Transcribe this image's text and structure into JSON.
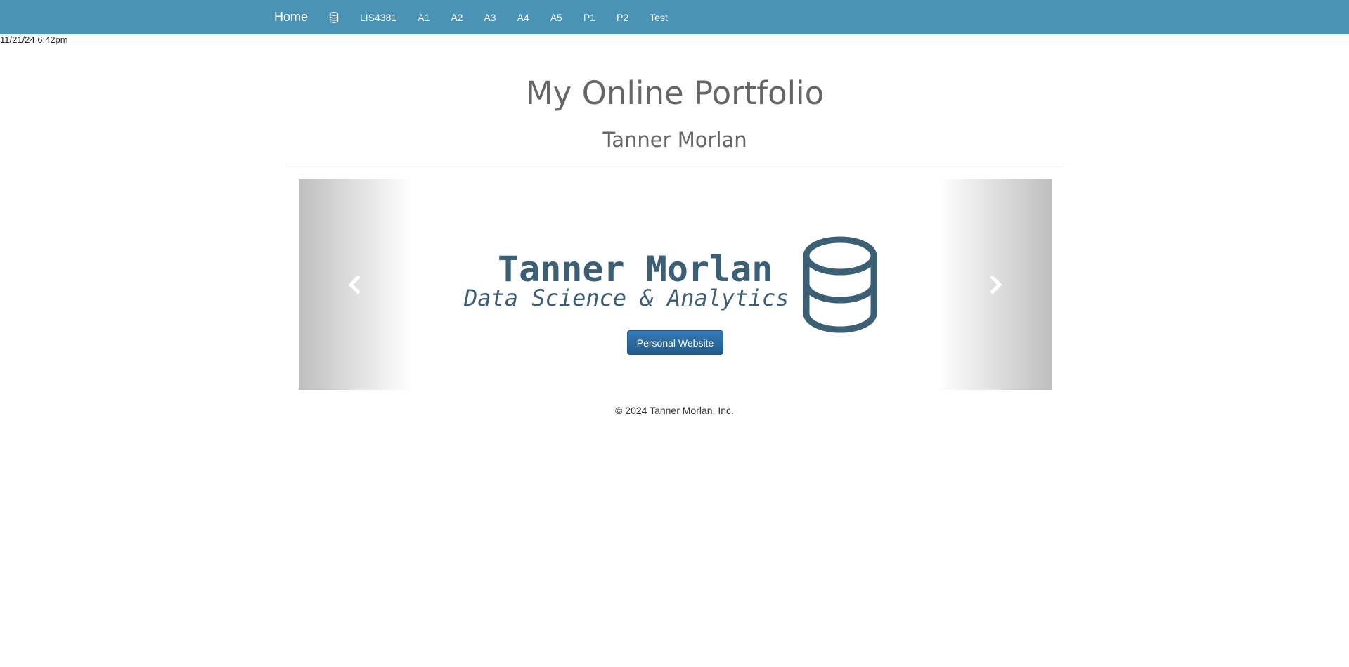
{
  "navbar": {
    "brand": "Home",
    "icon": "database-icon",
    "links": [
      "LIS4381",
      "A1",
      "A2",
      "A3",
      "A4",
      "A5",
      "P1",
      "P2",
      "Test"
    ],
    "background": "#4a92b6"
  },
  "timestamp": "11/21/24 6:42pm",
  "header": {
    "title": "My Online Portfolio",
    "subtitle": "Tanner Morlan"
  },
  "carousel": {
    "prev_icon": "chevron-left-icon",
    "next_icon": "chevron-right-icon",
    "slide": {
      "name": "Tanner Morlan",
      "tagline": "Data Science & Analytics",
      "logo_icon": "database-icon",
      "button_label": "Personal Website",
      "accent": "#3b6076"
    }
  },
  "footer": {
    "copyright": "© 2024 Tanner Morlan, Inc."
  }
}
